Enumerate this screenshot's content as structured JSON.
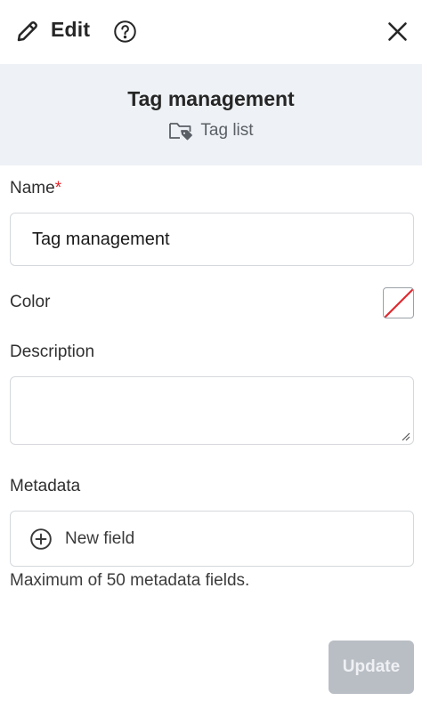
{
  "header": {
    "title": "Edit",
    "edit_icon": "pencil-icon",
    "help_icon": "question-circle-icon",
    "close_icon": "close-icon"
  },
  "banner": {
    "title": "Tag management",
    "link_label": "Tag list",
    "link_icon": "tag-folder-icon"
  },
  "form": {
    "name_label": "Name",
    "name_required_mark": "*",
    "name_value": "Tag management",
    "color_label": "Color",
    "color_value": "none",
    "description_label": "Description",
    "description_value": "",
    "metadata_label": "Metadata",
    "new_field_label": "New field",
    "metadata_hint": "Maximum of 50 metadata fields."
  },
  "actions": {
    "update_label": "Update"
  },
  "colors": {
    "banner_bg": "#eef2f6",
    "required": "#e0282e",
    "button_disabled_bg": "#b9bec5",
    "swatch_slash": "#e0282e"
  }
}
